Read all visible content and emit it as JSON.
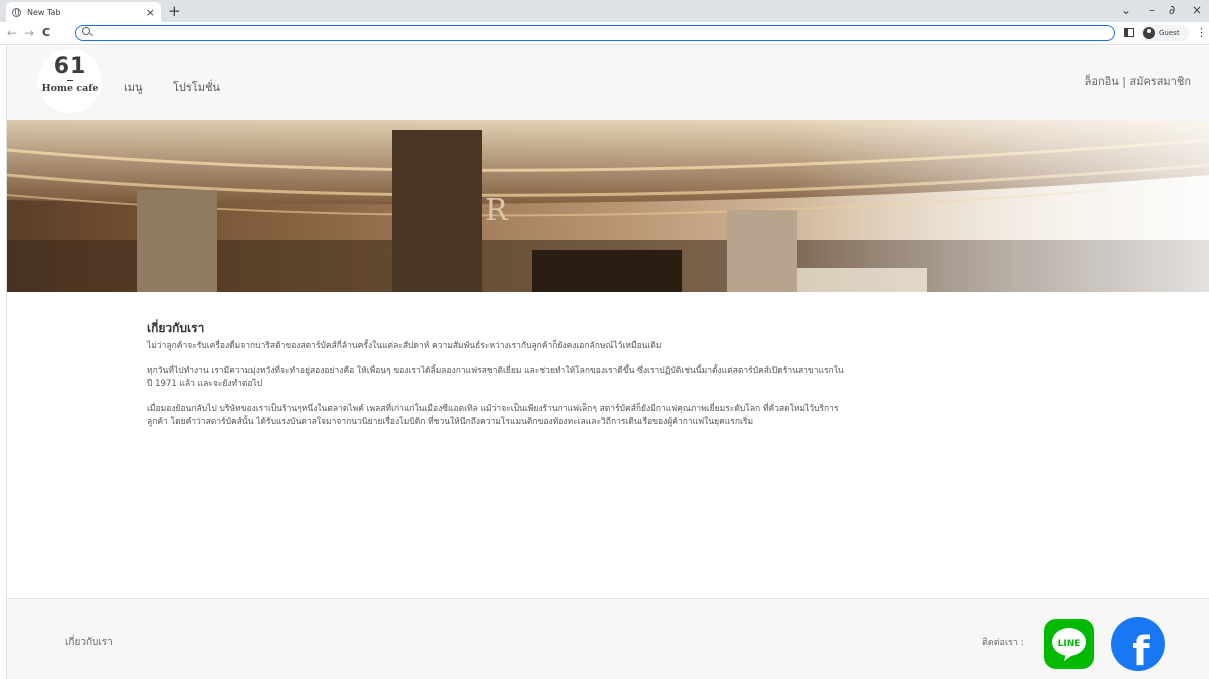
{
  "browser": {
    "tab_title": "New Tab",
    "tab_close": "×",
    "new_tab": "+",
    "minimize": "–",
    "restore": "∂",
    "close": "×",
    "dropdown": "⌄",
    "back": "←",
    "forward": "→",
    "reload": "C",
    "profile_label": "Guest",
    "menu": "⋮"
  },
  "header": {
    "logo_number": "61",
    "logo_text": "Home cafe",
    "nav": [
      "เมนู",
      "โปรโมชั่น"
    ],
    "auth_links": "ล็อกอิน | สมัครสมาชิก"
  },
  "about": {
    "title": "เกี่ยวกับเรา",
    "paragraphs": [
      "ไม่ว่าลูกค้าจะรับเครื่องดื่มจากบาริสต้าของสตาร์บัคส์กี่ล้านครั้งในแต่ละสัปดาห์ ความสัมพันธ์ระหว่างเรากับลูกค้าก็ยังคงเอกลักษณ์ไว้เหมือนเดิม",
      "ทุกวันที่ไปทำงาน เรามีความมุ่งหวังที่จะทำอยู่สองอย่างคือ ให้เพื่อนๆ ของเราได้ลิ้มลองกาแฟรสชาติเยี่ยม และช่วยทำให้โลกของเราดีขึ้น ซึ่งเราปฏิบัติเช่นนี้มาตั้งแต่สตาร์บัคส์เปิดร้านสาขาแรกในปี 1971 แล้ว และจะยังทำต่อไป",
      "เมื่อมองย้อนกลับไป บริษัทของเราเป็นร้านๆหนึ่งในตลาดไพค์ เพลสที่เก่าแก่ในเมืองซีแอตเทิล แม้ว่าจะเป็นเพียงร้านกาแฟเล็กๆ สตาร์บัคส์ก็ยังมีกาแฟคุณภาพเยี่ยมระดับโลก ที่คั่วสดใหม่ไว้บริการลูกค้า โดยคำว่าสตาร์บัคส์นั้น ได้รับแรงบันดาลใจมาจากนวนิยายเรื่องโมบิดิก ที่ชวนให้นึกถึงความโรแมนติกของท้องทะเลและวิถีการเดินเรือของผู้ค้ากาแฟในยุคแรกเริ่ม"
    ]
  },
  "footer": {
    "about_link": "เกี่ยวกับเรา",
    "contact_label": "ติดต่อเรา :",
    "line_label": "LINE",
    "facebook_glyph": "f"
  },
  "colors": {
    "line_green": "#00b900",
    "facebook_blue": "#1877f2",
    "omnibox_border": "#1a73e8"
  }
}
